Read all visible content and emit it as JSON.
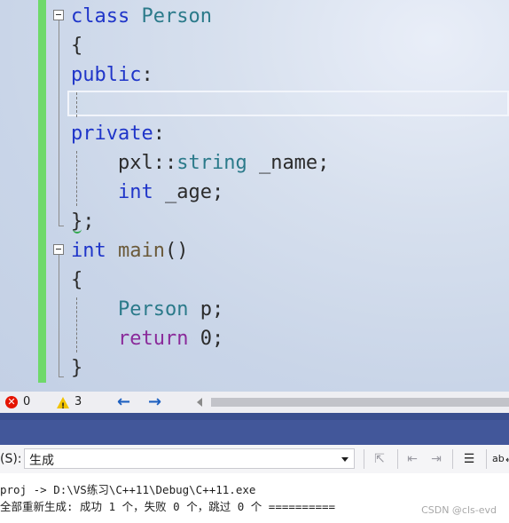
{
  "editor": {
    "lines": [
      {
        "tokens": [
          {
            "t": "class",
            "c": "kw"
          },
          {
            "t": " Person",
            "c": "ty"
          }
        ]
      },
      {
        "tokens": [
          {
            "t": "{",
            "c": "tx"
          }
        ]
      },
      {
        "tokens": [
          {
            "t": "public",
            "c": "kw"
          },
          {
            "t": ":",
            "c": "tx"
          }
        ]
      },
      {
        "tokens": [
          {
            "t": "",
            "c": "tx"
          }
        ]
      },
      {
        "tokens": [
          {
            "t": "private",
            "c": "kw"
          },
          {
            "t": ":",
            "c": "tx"
          }
        ]
      },
      {
        "tokens": [
          {
            "t": "    pxl",
            "c": "tx"
          },
          {
            "t": "::",
            "c": "tx"
          },
          {
            "t": "string",
            "c": "ty"
          },
          {
            "t": " _name;",
            "c": "tx"
          }
        ]
      },
      {
        "tokens": [
          {
            "t": "    ",
            "c": "tx"
          },
          {
            "t": "int",
            "c": "kw"
          },
          {
            "t": " _age;",
            "c": "tx"
          }
        ]
      },
      {
        "tokens": [
          {
            "t": "};",
            "c": "tx"
          }
        ]
      },
      {
        "tokens": [
          {
            "t": "int",
            "c": "kw"
          },
          {
            "t": " main",
            "c": "fn"
          },
          {
            "t": "()",
            "c": "tx"
          }
        ]
      },
      {
        "tokens": [
          {
            "t": "{",
            "c": "tx"
          }
        ]
      },
      {
        "tokens": [
          {
            "t": "    ",
            "c": "tx"
          },
          {
            "t": "Person",
            "c": "ty"
          },
          {
            "t": " p;",
            "c": "tx"
          }
        ]
      },
      {
        "tokens": [
          {
            "t": "    ",
            "c": "tx"
          },
          {
            "t": "return",
            "c": "ctl"
          },
          {
            "t": " 0;",
            "c": "tx"
          }
        ]
      },
      {
        "tokens": [
          {
            "t": "}",
            "c": "tx"
          }
        ]
      }
    ]
  },
  "status": {
    "errors": "0",
    "warnings": "3",
    "back_arrow": "←",
    "forward_arrow": "→"
  },
  "output": {
    "source_label": "(S):",
    "source_value": "生成",
    "lines": [
      "proj -> D:\\VS练习\\C++11\\Debug\\C++11.exe",
      "全部重新生成: 成功 1 个，失败 0 个，跳过 0 个 =========="
    ]
  },
  "watermark": "CSDN @cls-evd",
  "colors": {
    "keyword": "#1f35c9",
    "type": "#2b7a8a",
    "control": "#8a2a9a",
    "change_bar": "#6fd96a",
    "panel_band": "#42579a"
  }
}
